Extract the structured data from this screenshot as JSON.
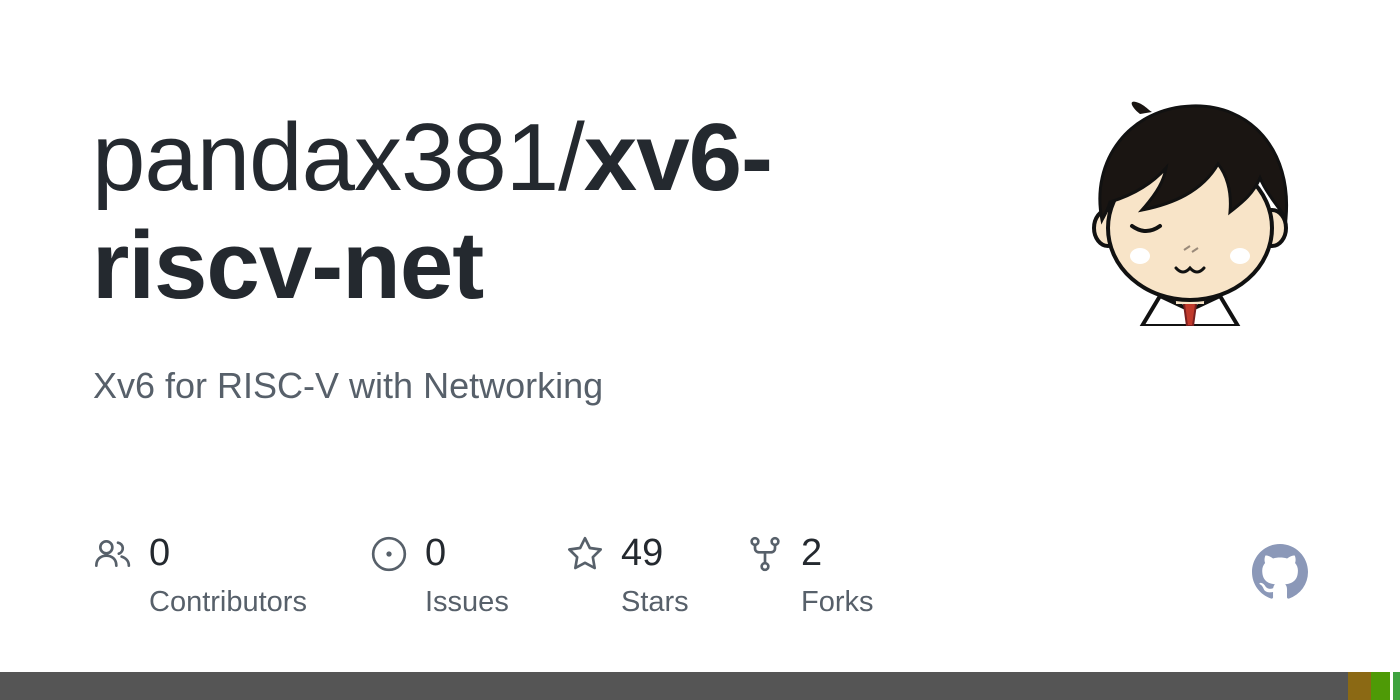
{
  "repo": {
    "owner": "pandax381/",
    "name": "xv6-riscv-net",
    "description": "Xv6 for RISC-V with Networking"
  },
  "stats": [
    {
      "icon": "people-icon",
      "count": "0",
      "label": "Contributors"
    },
    {
      "icon": "issue-icon",
      "count": "0",
      "label": "Issues"
    },
    {
      "icon": "star-icon",
      "count": "49",
      "label": "Stars"
    },
    {
      "icon": "fork-icon",
      "count": "2",
      "label": "Forks"
    }
  ],
  "colors": {
    "title": "#24292f",
    "muted": "#57606a",
    "icon": "#57606a",
    "github_logo": "#8b98b8"
  },
  "language_bar": [
    {
      "color": "#555555",
      "share": 0.963
    },
    {
      "color": "#8b6914",
      "share": 0.016
    },
    {
      "color": "#4e9a06",
      "share": 0.014
    },
    {
      "color": "#ffffff",
      "share": 0.002
    },
    {
      "color": "#3fa33f",
      "share": 0.005
    }
  ]
}
